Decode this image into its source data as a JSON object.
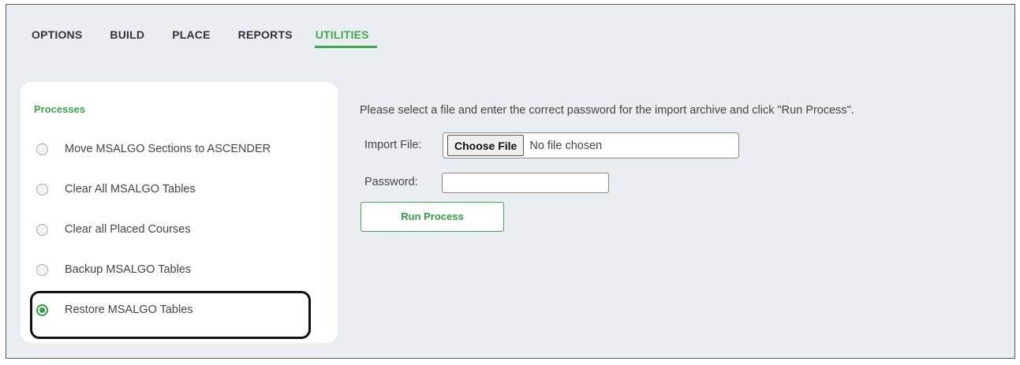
{
  "tabs": [
    {
      "label": "OPTIONS",
      "active": false
    },
    {
      "label": "BUILD",
      "active": false
    },
    {
      "label": "PLACE",
      "active": false
    },
    {
      "label": "REPORTS",
      "active": false
    },
    {
      "label": "UTILITIES",
      "active": true
    }
  ],
  "sidebar": {
    "title": "Processes",
    "items": [
      {
        "label": "Move MSALGO Sections to ASCENDER",
        "selected": false
      },
      {
        "label": "Clear All MSALGO Tables",
        "selected": false
      },
      {
        "label": "Clear all Placed Courses",
        "selected": false
      },
      {
        "label": "Backup MSALGO Tables",
        "selected": false
      },
      {
        "label": "Restore MSALGO Tables",
        "selected": true
      }
    ]
  },
  "main": {
    "instructions": "Please select a file and enter the correct password for the import archive and click \"Run Process\".",
    "import_file_label": "Import File:",
    "choose_file_label": "Choose File",
    "no_file_text": "No file chosen",
    "password_label": "Password:",
    "password_value": "",
    "run_button_label": "Run Process"
  },
  "colors": {
    "accent": "#3aaa4a",
    "panel_background": "#eaeef2",
    "highlight_border": "#111111"
  }
}
